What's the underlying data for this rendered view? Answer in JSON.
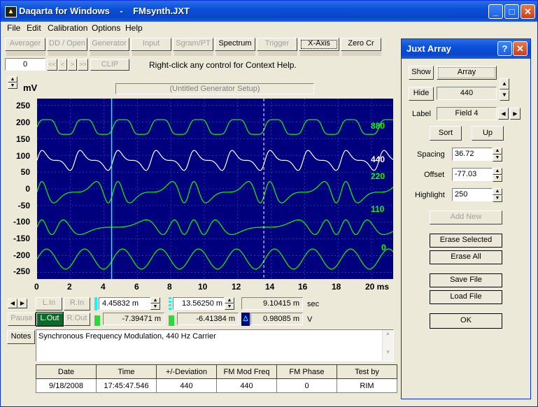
{
  "window": {
    "title": "Daqarta for Windows    -    FMsynth.JXT",
    "minimize": "_",
    "maximize": "□",
    "close": "✕"
  },
  "menu": [
    "File",
    "Edit",
    "Calibration",
    "Options",
    "Help"
  ],
  "toolbar": {
    "buttons": [
      "Averager",
      "DD / Open",
      "Generator",
      "Input",
      "Sgram/PT",
      "Spectrum",
      "Trigger",
      "X-Axis",
      "Zero Cr"
    ],
    "counter": "0",
    "nav": [
      "<<",
      "<",
      ">",
      ">>"
    ],
    "clip": "CLIP",
    "help_text": "Right-click any control for Context Help."
  },
  "plot": {
    "unit_label": "mV",
    "setup_label": "(Untitled Generator Setup)",
    "y_ticks": [
      "250",
      "200",
      "150",
      "100",
      "50",
      "0",
      "-50",
      "-100",
      "-150",
      "-200",
      "-250"
    ],
    "x_ticks": [
      "0",
      "2",
      "4",
      "6",
      "8",
      "10",
      "12",
      "14",
      "16",
      "18",
      "20 ms"
    ],
    "trace_labels": [
      "880",
      "440",
      "220",
      "110",
      "0"
    ],
    "colors": {
      "background": "#00007e",
      "grid": "#2f2fb0",
      "trace_green": "#00ff00",
      "trace_white": "#ffffff",
      "cursor": "#00ffff"
    }
  },
  "readouts": {
    "left_buttons": [
      "L.In",
      "R.In"
    ],
    "out_buttons": [
      "Pause",
      "L.Out",
      "R.Out"
    ],
    "cursor1_time": "4.45832 m",
    "cursor2_time": "13.56250 m",
    "delta_time": "9.10415 m",
    "time_unit": "sec",
    "cursor1_volt": "-7.39471 m",
    "cursor2_volt": "-6.41384 m",
    "delta_volt": "0.98085 m",
    "volt_unit": "V",
    "delta_symbol": "Δ"
  },
  "notes": {
    "button": "Notes",
    "text": "Synchronous Frequency Modulation, 440 Hz Carrier"
  },
  "table": {
    "headers": [
      "Date",
      "Time",
      "+/-Deviation",
      "FM Mod Freq",
      "FM Phase",
      "Test by"
    ],
    "values": [
      "9/18/2008",
      "17:45:47.546",
      "440",
      "440",
      "0",
      "RIM"
    ]
  },
  "juxt": {
    "title": "Juxt Array",
    "help": "?",
    "close": "✕",
    "show": "Show",
    "array": "Array",
    "hide": "Hide",
    "hide_value": "440",
    "label": "Label",
    "label_value": "Field 4",
    "sort": "Sort",
    "up": "Up",
    "spacing_label": "Spacing",
    "spacing": "36.72",
    "offset_label": "Offset",
    "offset": "-77.03",
    "highlight_label": "Highlight",
    "highlight": "250",
    "add_new": "Add New",
    "erase_selected": "Erase Selected",
    "erase_all": "Erase All",
    "save_file": "Save File",
    "load_file": "Load File",
    "ok": "OK"
  }
}
